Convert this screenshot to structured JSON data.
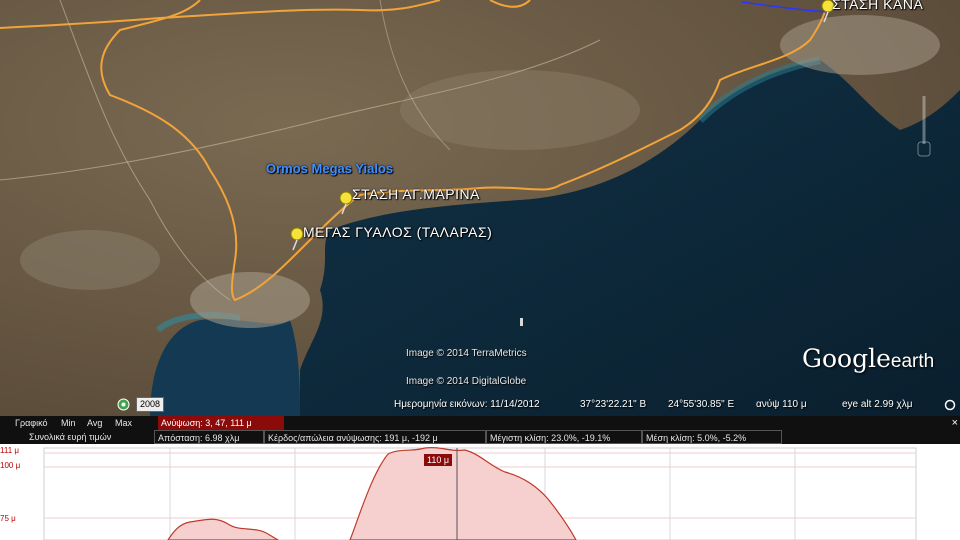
{
  "map": {
    "bay_label": "Ormos Megas Yialos",
    "placemarks": [
      {
        "label": "ΣΤΑΣΗ ΚΑΝΑ"
      },
      {
        "label": "ΣΤΑΣΗ ΑΓ.ΜΑΡΙΝΑ"
      },
      {
        "label": "ΜΕΓΑΣ ΓΥΑΛΟΣ (ΤΑΛΑΡΑΣ)"
      }
    ],
    "credits": [
      "Image © 2014 TerraMetrics",
      "Image © 2014 DigitalGlobe"
    ],
    "logo": {
      "google": "Google",
      "earth": "earth"
    },
    "year_badge": "2008",
    "status": {
      "imagery_date": "Ημερομηνία εικόνων: 11/14/2012",
      "lat": "37°23'22.21\" Β",
      "lon": "24°55'30.85\" Ε",
      "elev": "ανύψ    110 μ",
      "eye_alt": "eye alt   2.99 χλμ"
    },
    "colors": {
      "route": "#f2a43a",
      "water": "#0d2a3c",
      "land": "#6b5a45"
    }
  },
  "profile": {
    "row1": {
      "graph_label": "Γραφικό",
      "opts": [
        "Min",
        "Avg",
        "Max"
      ],
      "elevation": "Ανύψωση: 3, 47, 111 μ"
    },
    "row2": {
      "totals": "Συνολικά ευρή τιμών",
      "distance": "Απόσταση: 6.98 χλμ",
      "gain_loss": "Κέρδος/απώλεια ανύψωσης:  191 μ, -192 μ",
      "max_slope": "Μέγιστη κλίση:  23.0%, -19.1%",
      "avg_slope": "Μέση κλίση:  5.0%, -5.2%"
    },
    "close": "×",
    "yticks": [
      "111 μ",
      "100 μ",
      "75 μ"
    ],
    "cursor_value": "110 μ",
    "colors": {
      "line": "#c0392b",
      "fill": "#f6d0ce"
    }
  }
}
